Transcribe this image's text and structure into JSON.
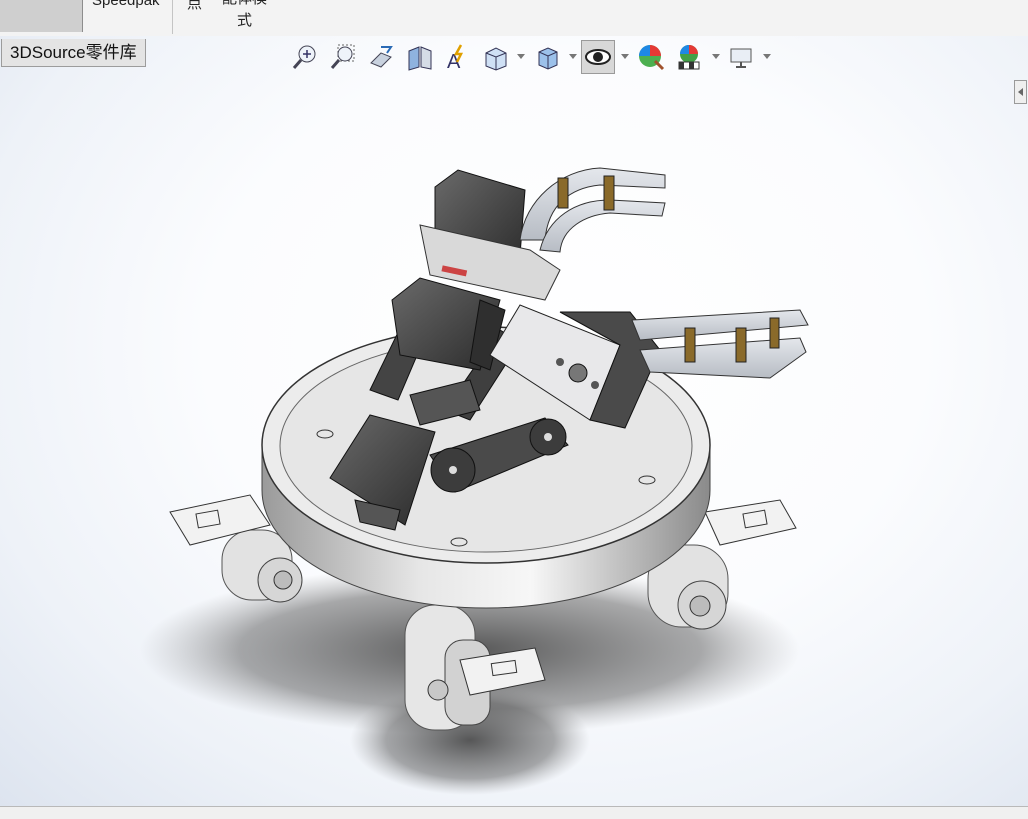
{
  "ribbon": {
    "tab_speedpak": "Speedpak",
    "tab_point": "点",
    "tab_assembly_line1": "配体模",
    "tab_assembly_line2": "式"
  },
  "library_tab": {
    "label": "3DSource零件库"
  },
  "heads_up_toolbar": [
    {
      "icon": "zoom-to-fit-icon",
      "dropdown": false,
      "active": false
    },
    {
      "icon": "zoom-to-area-icon",
      "dropdown": false,
      "active": false
    },
    {
      "icon": "previous-view-icon",
      "dropdown": false,
      "active": false
    },
    {
      "icon": "section-view-icon",
      "dropdown": false,
      "active": false
    },
    {
      "icon": "dynamic-annotation-icon",
      "dropdown": false,
      "active": false
    },
    {
      "icon": "view-orientation-icon",
      "dropdown": true,
      "active": false
    },
    {
      "icon": "display-style-icon",
      "dropdown": true,
      "active": false
    },
    {
      "icon": "hide-show-items-icon",
      "dropdown": true,
      "active": true
    },
    {
      "icon": "edit-appearance-icon",
      "dropdown": false,
      "active": false
    },
    {
      "icon": "apply-scene-icon",
      "dropdown": true,
      "active": false
    },
    {
      "icon": "view-settings-icon",
      "dropdown": true,
      "active": false
    }
  ],
  "colors": {
    "ribbon_bg": "#f3f3f3",
    "viewport_edge": "#dde4ef",
    "servo_dark": "#3d3d3d",
    "platform_light": "#e9e9e9",
    "acrylic": "#c9cdd3"
  }
}
